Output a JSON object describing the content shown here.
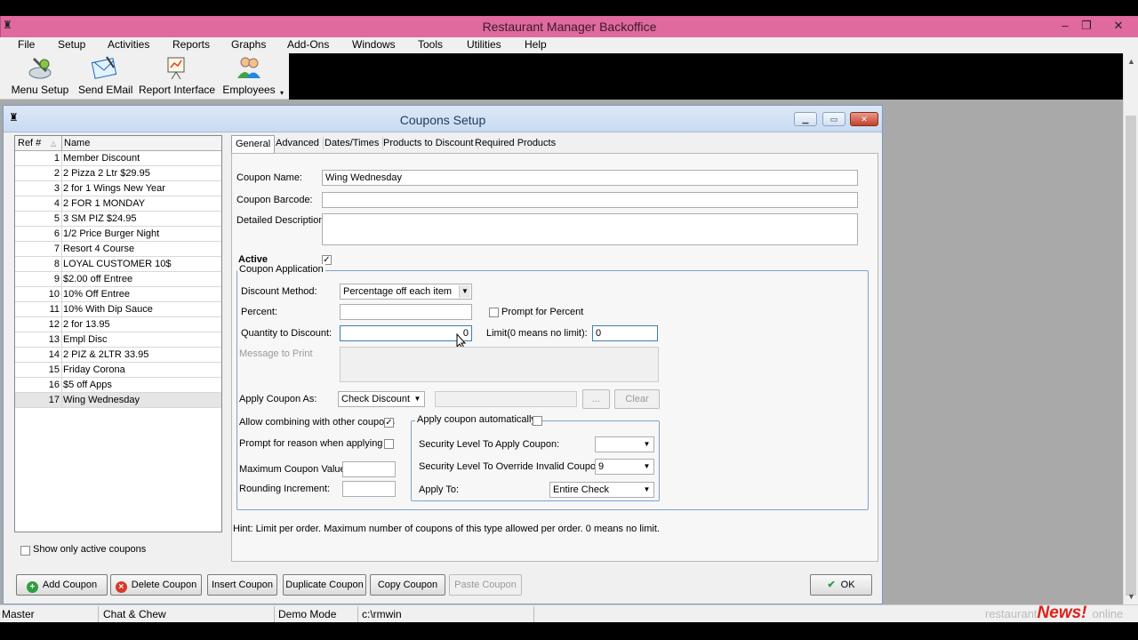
{
  "app": {
    "title": "Restaurant Manager Backoffice"
  },
  "menu": [
    "File",
    "Setup",
    "Activities",
    "Reports",
    "Graphs",
    "Add-Ons",
    "Windows",
    "Tools",
    "Utilities",
    "Help"
  ],
  "toolbar": {
    "menu_setup": "Menu Setup",
    "send_email": "Send EMail",
    "report_interface": "Report Interface",
    "employees": "Employees"
  },
  "dialog": {
    "title": "Coupons Setup",
    "list": {
      "col_ref": "Ref #",
      "col_name": "Name",
      "rows": [
        {
          "ref": "1",
          "name": "Member Discount"
        },
        {
          "ref": "2",
          "name": "2 Pizza 2 Ltr $29.95"
        },
        {
          "ref": "3",
          "name": "2 for 1 Wings New Year"
        },
        {
          "ref": "4",
          "name": "2 FOR 1 MONDAY"
        },
        {
          "ref": "5",
          "name": "3 SM PIZ  $24.95"
        },
        {
          "ref": "6",
          "name": "1/2 Price Burger Night"
        },
        {
          "ref": "7",
          "name": "Resort 4 Course"
        },
        {
          "ref": "8",
          "name": "LOYAL CUSTOMER 10$"
        },
        {
          "ref": "9",
          "name": "$2.00 off Entree"
        },
        {
          "ref": "10",
          "name": "10% Off Entree"
        },
        {
          "ref": "11",
          "name": "10% With Dip Sauce"
        },
        {
          "ref": "12",
          "name": "2 for 13.95"
        },
        {
          "ref": "13",
          "name": "Empl Disc"
        },
        {
          "ref": "14",
          "name": "2 PIZ & 2LTR 33.95"
        },
        {
          "ref": "15",
          "name": "Friday Corona"
        },
        {
          "ref": "16",
          "name": "$5 off Apps"
        },
        {
          "ref": "17",
          "name": "Wing Wednesday"
        }
      ],
      "selected_index": 16,
      "show_active_label": "Show only active coupons"
    },
    "tabs": [
      "General",
      "Advanced",
      "Dates/Times",
      "Products to Discount",
      "Required Products"
    ],
    "active_tab": "General",
    "general": {
      "coupon_name_label": "Coupon Name:",
      "coupon_name": "Wing Wednesday",
      "coupon_barcode_label": "Coupon Barcode:",
      "coupon_barcode": "",
      "detailed_description_label": "Detailed Description:",
      "detailed_description": "",
      "active_label": "Active",
      "active_checked": true,
      "coupon_application_title": "Coupon Application",
      "discount_method_label": "Discount Method:",
      "discount_method": "Percentage off each item",
      "percent_label": "Percent:",
      "percent": "",
      "prompt_for_percent_label": "Prompt for Percent",
      "quantity_label": "Quantity to Discount:",
      "quantity": "0",
      "limit_label": "Limit(0 means no limit):",
      "limit": "0",
      "message_label": "Message to Print",
      "apply_as_label": "Apply Coupon As:",
      "apply_as": "Check Discount",
      "browse_label": "...",
      "clear_label": "Clear",
      "allow_combining_label": "Allow combining with other coupons",
      "allow_combining_checked": true,
      "prompt_reason_label": "Prompt for reason when applying",
      "max_value_label": "Maximum Coupon Value:",
      "rounding_label": "Rounding Increment:",
      "auto_apply_label": "Apply coupon automatically",
      "security_apply_label": "Security Level To Apply Coupon:",
      "security_apply": "",
      "security_override_label": "Security Level To Override Invalid Coupons:",
      "security_override": "9",
      "apply_to_label": "Apply To:",
      "apply_to": "Entire Check"
    },
    "hint": "Hint: Limit per order. Maximum number of coupons of this type allowed per order. 0 means no limit.",
    "buttons": {
      "add": "Add Coupon",
      "delete": "Delete Coupon",
      "insert": "Insert Coupon",
      "duplicate": "Duplicate Coupon",
      "copy": "Copy Coupon",
      "paste": "Paste Coupon",
      "ok": "OK"
    }
  },
  "status": {
    "user": "Master",
    "store": "Chat & Chew",
    "mode": "Demo Mode",
    "path": "c:\\rmwin",
    "brand_left": "restaurant",
    "brand_news": "News!",
    "brand_right": "online"
  },
  "colors": {
    "titlebar": "#e0699d",
    "accent": "#7da2ce"
  }
}
